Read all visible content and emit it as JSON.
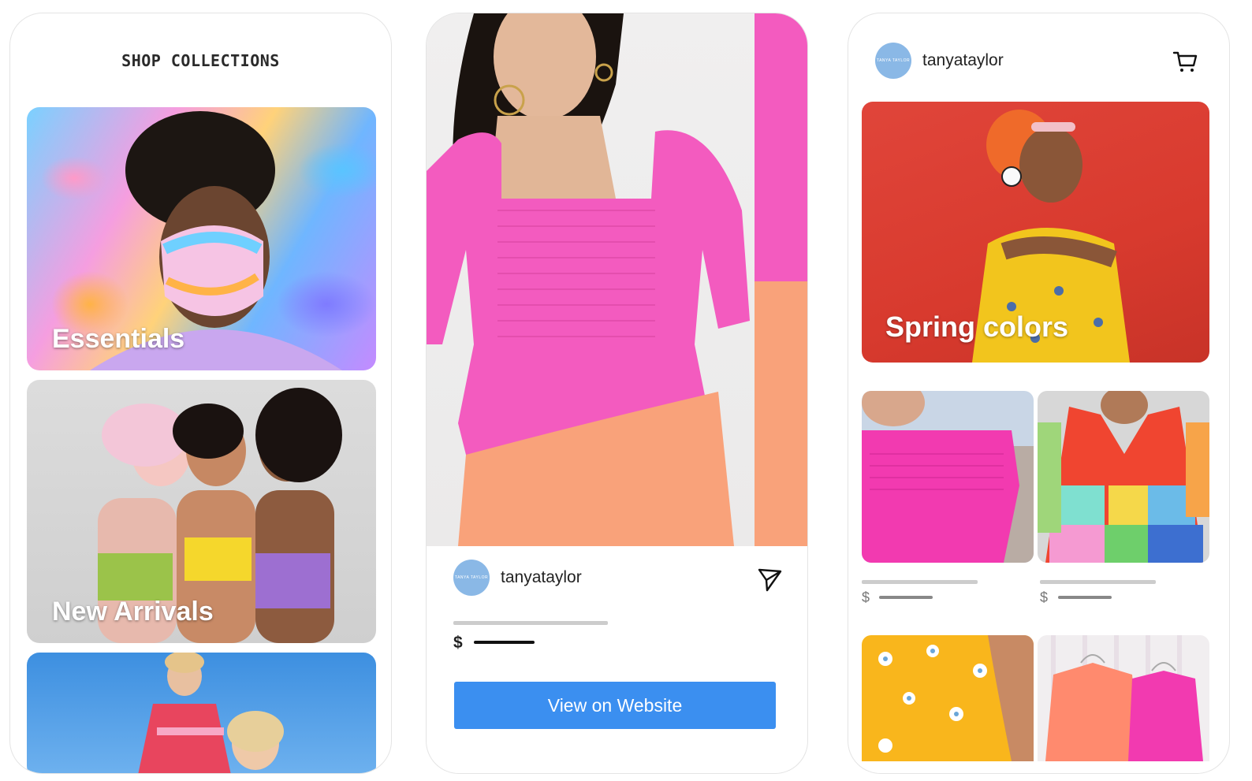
{
  "panel1": {
    "title": "SHOP COLLECTIONS",
    "collections": [
      {
        "label": "Essentials"
      },
      {
        "label": "New Arrivals"
      },
      {
        "label": ""
      }
    ]
  },
  "panel2": {
    "username": "tanyataylor",
    "avatar_text": "TANYA TAYLOR",
    "currency": "$",
    "button_label": "View on Website",
    "colors": {
      "accent": "#3b8ff0",
      "dress_pink": "#f35bbf",
      "dress_peach": "#f9a27a"
    }
  },
  "panel3": {
    "username": "tanyataylor",
    "avatar_text": "TANYA TAYLOR",
    "hero_label": "Spring colors",
    "products": [
      {
        "currency": "$"
      },
      {
        "currency": "$"
      }
    ],
    "icons": {
      "cart": "cart-icon",
      "send": "send-icon"
    }
  }
}
